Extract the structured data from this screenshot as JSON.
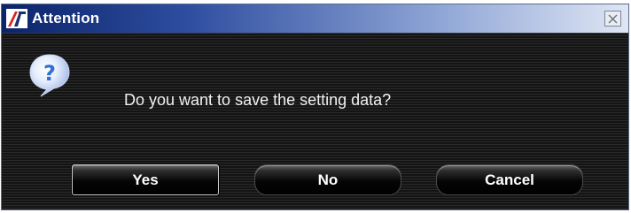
{
  "window": {
    "title": "Attention",
    "icon": "app-logo-icon",
    "close_icon": "close-icon"
  },
  "dialog": {
    "icon": "question-icon",
    "message": "Do you want to save the setting data?",
    "buttons": {
      "yes": "Yes",
      "no": "No",
      "cancel": "Cancel"
    },
    "default_button": "yes"
  },
  "colors": {
    "title_gradient_start": "#0a246a",
    "title_gradient_end": "#dfe6f4",
    "background": "#1a1a1a",
    "text": "#f2f2f2",
    "question_blue": "#2f6fd6"
  }
}
